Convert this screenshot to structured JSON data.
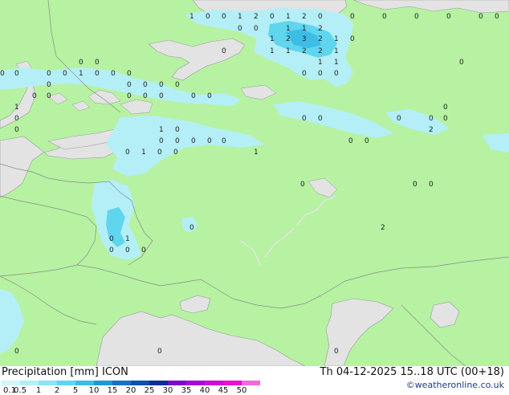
{
  "map": {
    "title": "Precipitation [mm]",
    "model": "ICON",
    "datetime": "Th 04-12-2025 15..18 UTC (00+18)",
    "credit": "©weatheronline.co.uk",
    "colors": {
      "land": "#b6f2a2",
      "sea": "#e3e3e3",
      "border": "#8a8a8a"
    },
    "precip_labels": [
      "1",
      "0",
      "0",
      "1",
      "2",
      "0",
      "1",
      "2",
      "0",
      "0",
      "0",
      "0",
      "0",
      "0",
      "0",
      "0",
      "0",
      "1",
      "1",
      "2",
      "1",
      "2",
      "3",
      "2",
      "1",
      "0",
      "1",
      "1",
      "2",
      "2",
      "1",
      "0",
      "1",
      "1",
      "0",
      "0",
      "0",
      "0",
      "0",
      "0",
      "0",
      "0",
      "0",
      "0",
      "1",
      "0",
      "0",
      "0",
      "0",
      "0",
      "0",
      "0",
      "0",
      "0",
      "0",
      "0",
      "0",
      "1",
      "0",
      "0",
      "0",
      "0",
      "0",
      "0",
      "1",
      "0",
      "0",
      "0",
      "0",
      "0",
      "0",
      "0",
      "0",
      "0",
      "0",
      "0",
      "0",
      "0",
      "0",
      "1",
      "0",
      "0",
      "1",
      "2",
      "0",
      "1",
      "0",
      "0",
      "0",
      "0",
      "0",
      "0",
      "2",
      "0",
      "0",
      "0",
      "0"
    ]
  },
  "legend": {
    "items": [
      {
        "label": "0.1",
        "color": "#d2f7fa"
      },
      {
        "label": "0.5",
        "color": "#b4eff7"
      },
      {
        "label": "1",
        "color": "#8ae4f2"
      },
      {
        "label": "2",
        "color": "#5fd5ee"
      },
      {
        "label": "5",
        "color": "#3bbde6"
      },
      {
        "label": "10",
        "color": "#1c9ad8"
      },
      {
        "label": "15",
        "color": "#1573c6"
      },
      {
        "label": "20",
        "color": "#0f4fb0"
      },
      {
        "label": "25",
        "color": "#0b2d94"
      },
      {
        "label": "30",
        "color": "#7a0ad2"
      },
      {
        "label": "35",
        "color": "#a70ad8"
      },
      {
        "label": "40",
        "color": "#cf0bd8"
      },
      {
        "label": "45",
        "color": "#e80fce"
      },
      {
        "label": "50",
        "color": "#f26bd9"
      }
    ]
  }
}
